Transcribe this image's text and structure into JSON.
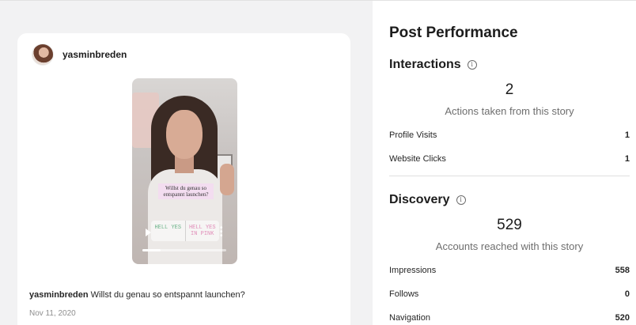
{
  "post": {
    "username": "yasminbreden",
    "caption_user": "yasminbreden",
    "caption_text": "Willst du genau so entspannt launchen?",
    "date": "Nov 11, 2020",
    "story": {
      "question_sticker": "Willst du genau so entspannt launchen?",
      "poll_option_1": "HELL YES",
      "poll_option_2": "HELL YES IN PINK",
      "progress": 0.22
    }
  },
  "performance": {
    "title": "Post Performance",
    "interactions": {
      "heading": "Interactions",
      "total": "2",
      "total_label": "Actions taken from this story",
      "rows": [
        {
          "label": "Profile Visits",
          "value": "1"
        },
        {
          "label": "Website Clicks",
          "value": "1"
        }
      ]
    },
    "discovery": {
      "heading": "Discovery",
      "total": "529",
      "total_label": "Accounts reached with this story",
      "rows": [
        {
          "label": "Impressions",
          "value": "558"
        },
        {
          "label": "Follows",
          "value": "0"
        },
        {
          "label": "Navigation",
          "value": "520"
        }
      ]
    }
  },
  "icons": {
    "info": "info-icon",
    "play": "play-icon",
    "more": "more-vertical-icon"
  },
  "colors": {
    "background": "#f2f2f3",
    "card": "#ffffff",
    "text": "#262626",
    "muted": "#8e8e8e"
  }
}
